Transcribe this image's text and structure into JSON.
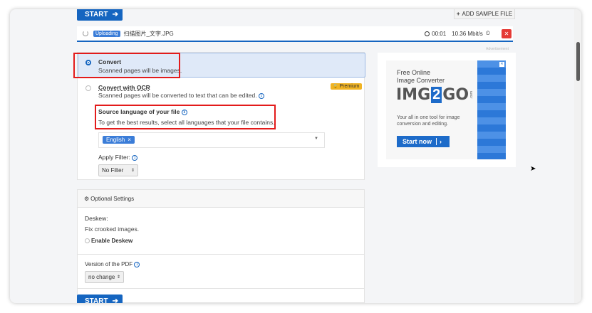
{
  "top_bar": {
    "start_label": "START",
    "add_sample_label": "ADD SAMPLE FILE"
  },
  "upload": {
    "status_badge": "Uploading",
    "file_name": "扫描图片_文字.JPG",
    "elapsed": "00:01",
    "speed": "10.36 Mbit/s"
  },
  "advertisement_label": "Advertisement",
  "convert_options": {
    "convert": {
      "title": "Convert",
      "desc": "Scanned pages will be images."
    },
    "convert_ocr": {
      "title": "Convert with OCR",
      "desc": "Scanned pages will be converted to text that can be edited.",
      "premium_label": "Premium"
    },
    "source_language": {
      "title": "Source language of your file",
      "desc": "To get the best results, select all languages that your file contains.",
      "selected_tag": "English"
    },
    "apply_filter": {
      "label": "Apply Filter:",
      "value": "No Filter"
    }
  },
  "optional_settings": {
    "header": "Optional Settings",
    "deskew_title": "Deskew:",
    "deskew_desc": "Fix crooked images.",
    "enable_deskew_label": "Enable Deskew",
    "pdf_version_label": "Version of the PDF",
    "pdf_version_value": "no change"
  },
  "ad": {
    "line1": "Free Online",
    "line2": "Image Converter",
    "logo_left": "IMG",
    "logo_mid": "2",
    "logo_right": "GO",
    "logo_com": ".com",
    "tagline": "Your all in one tool for image conversion and editing.",
    "cta": "Start now"
  },
  "bottom_bar": {
    "start_label": "START"
  },
  "colors": {
    "primary": "#1565c0",
    "highlight_border": "#e31b1b",
    "premium_bg": "#f0b323",
    "cancel_red": "#e53935"
  }
}
